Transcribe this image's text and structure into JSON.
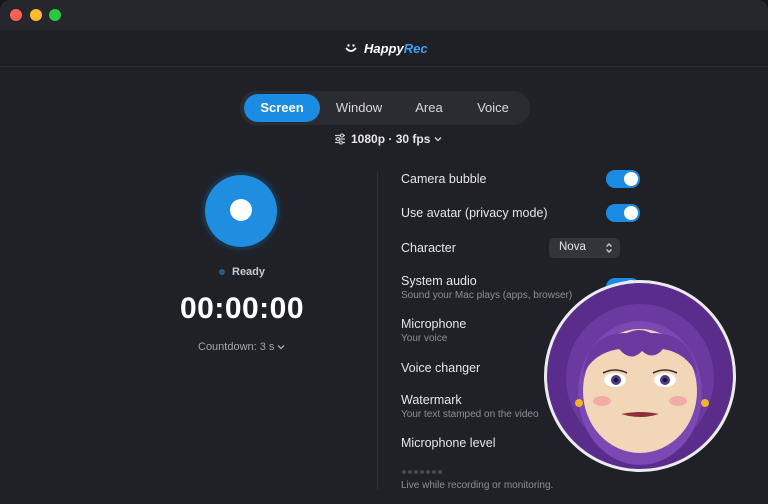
{
  "app": {
    "brand_name": "Happy",
    "brand_accent": "Rec"
  },
  "modes": {
    "tabs": [
      {
        "label": "Screen",
        "active": true
      },
      {
        "label": "Window",
        "active": false
      },
      {
        "label": "Area",
        "active": false
      },
      {
        "label": "Voice",
        "active": false
      }
    ]
  },
  "quality": {
    "label": "1080p · 30 fps",
    "icon": "sliders-icon"
  },
  "recorder": {
    "status": "Ready",
    "timer": "00:00:00",
    "countdown": "Countdown: 3 s"
  },
  "settings": {
    "camera_bubble": {
      "label": "Camera bubble",
      "on": true
    },
    "use_avatar": {
      "label": "Use avatar (privacy mode)",
      "on": true
    },
    "character": {
      "label": "Character",
      "value": "Nova"
    },
    "system_audio": {
      "label": "System audio",
      "sub": "Sound your Mac plays (apps, browser)"
    },
    "microphone": {
      "label": "Microphone",
      "sub": "Your voice"
    },
    "voice_changer": {
      "label": "Voice changer"
    },
    "watermark": {
      "label": "Watermark",
      "sub": "Your text stamped on the video"
    },
    "mic_level": {
      "label": "Microphone level",
      "hint": "Live while recording or monitoring."
    }
  },
  "colors": {
    "accent": "#1b8ce3",
    "bubble_purple": "#5b2f8e",
    "background": "#202126"
  }
}
